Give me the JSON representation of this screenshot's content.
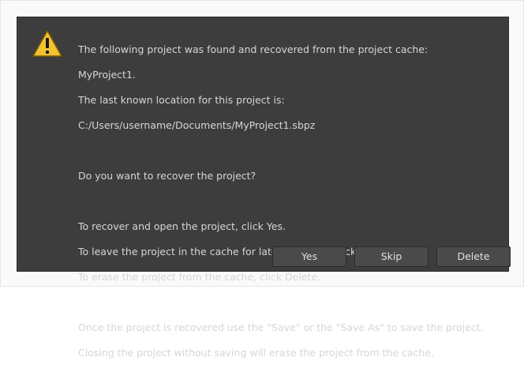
{
  "dialog": {
    "icon": "warning-icon",
    "lines": [
      "The following project was found and recovered from the project cache:",
      "MyProject1.",
      "The last known location for this project is:",
      "C:/Users/username/Documents/MyProject1.sbpz",
      "",
      "Do you want to recover the project?",
      "",
      "To recover and open the project, click Yes.",
      "To leave the project in the cache for later recovery, click Skip.",
      "To erase the project from the cache, click Delete.",
      "",
      "Once the project is recovered use the \"Save\" or the \"Save As\" to save the project.",
      "Closing the project without saving will erase the project from the cache."
    ],
    "buttons": {
      "yes": "Yes",
      "skip": "Skip",
      "delete": "Delete"
    },
    "colors": {
      "background": "#3d3d3d",
      "text": "#d6d6d6",
      "warning_fill": "#f2c230"
    }
  }
}
